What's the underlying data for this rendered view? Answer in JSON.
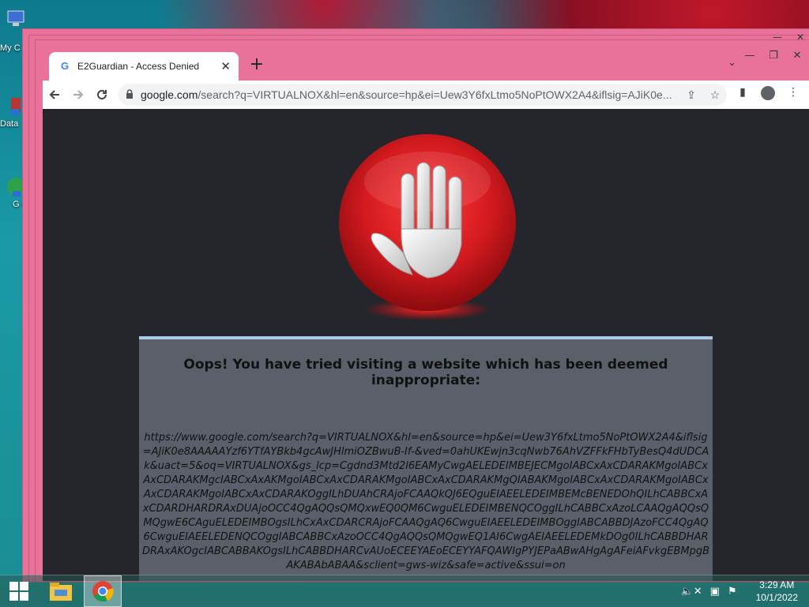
{
  "desktop": {
    "icons": [
      {
        "label": "My C",
        "icon": "computer-icon"
      },
      {
        "label": "Data",
        "icon": "shortcut-icon"
      },
      {
        "label": "G C",
        "icon": "chrome-shortcut-icon"
      }
    ]
  },
  "browser": {
    "tab": {
      "title": "E2Guardian - Access Denied",
      "favicon": "G",
      "close_glyph": "✕"
    },
    "new_tab_glyph": "+",
    "address": {
      "host": "google.com",
      "path": "/search?q=VIRTUALNOX&hl=en&source=hp&ei=Uew3Y6fxLtmo5NoPtOWX2A4&iflsig=AJiK0e..."
    }
  },
  "page": {
    "message_title": "Oops! You have tried visiting a website which has been deemed inappropriate:",
    "blocked_url": "https://www.google.com/search?q=VIRTUALNOX&hl=en&source=hp&ei=Uew3Y6fxLtmo5NoPtOWX2A4&iflsig=AJiK0e8AAAAAYzf6YTfAYBkb4gcAwJHlmiOZBwuB-If-&ved=0ahUKEwjn3cqNwb76AhVZFFkFHbTyBesQ4dUDCAk&uact=5&oq=VIRTUALNOX&gs_lcp=Cgdnd3Mtd2l6EAMyCwgAELEDEIMBEJECMgoIABCxAxCDARAKMgoIABCxAxCDARAKMgcIABCxAxAKMgoIABCxAxCDARAKMgoIABCxAxCDARAKMgQIABAKMgoIABCxAxCDARAKMgoIABCxAxCDARAKMgoIABCxAxCDARAKOggILhDUAhCRAjoFCAAQkQJ6EQguEIAEELEDEIMBEMcBENEDOhQILhCABBCxAxCDARDHARDRAxDUAjoOCC4QgAQQsQMQxwEQ0QM6CwguELEDEIMBENQCOggILhCABBCxAzoLCAAQgAQQsQMQgwE6CAguELEDEIMBOgsILhCxAxCDARCRAjoFCAAQgAQ6CwguEIAEELEDEIMBOggIABCABBDJAzoFCC4QgAQ6CwguEIAEELEDENQCOggIABCABBCxAzoOCC4QgAQQsQMQgwEQ1AI6CwgAEIAEELEDEMkDOg0ILhCABBDHARDRAxAKOgcIABCABBAKOgsILhCABBDHARCvAUoECEEYAEoECEYYAFQAWIgPYJEPaABwAHgAgAFeiAFvkgEBMpgBAKABAbABAA&sclient=gws-wiz&safe=active&ssui=on"
  },
  "taskbar": {
    "apps": [
      {
        "name": "file-explorer",
        "icon": "folder-icon",
        "active": false
      },
      {
        "name": "chrome",
        "icon": "chrome-icon",
        "active": true
      }
    ],
    "time": "3:29 AM",
    "date": "10/1/2022"
  },
  "colors": {
    "window_frame": "#e8729a",
    "page_bg": "#24262c",
    "panel_bg": "#5a5f6a",
    "panel_accent": "#a9cde8",
    "stop_red": "#d21a1f"
  }
}
